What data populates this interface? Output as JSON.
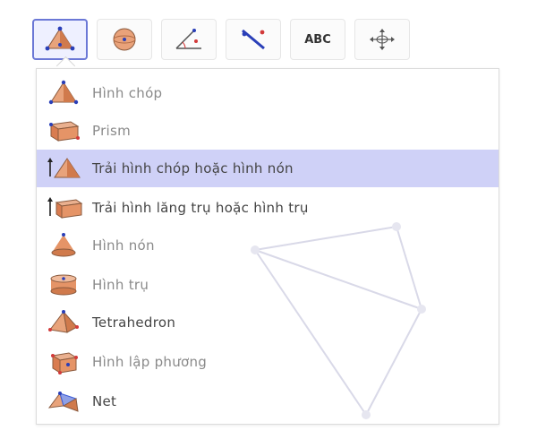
{
  "toolbar": {
    "tools": [
      {
        "name": "pyramid-tool",
        "icon": "pyramid-icon",
        "selected": true
      },
      {
        "name": "sphere-tool",
        "icon": "sphere-icon",
        "selected": false
      },
      {
        "name": "angle-tool",
        "icon": "angle-icon",
        "selected": false
      },
      {
        "name": "reflect-tool",
        "icon": "reflect-icon",
        "selected": false
      },
      {
        "name": "text-tool",
        "label": "ABC",
        "selected": false
      },
      {
        "name": "move-view-tool",
        "icon": "move-arrows-icon",
        "selected": false
      }
    ]
  },
  "menu": {
    "items": [
      {
        "label": "Hình chóp",
        "icon": "pyramid-icon"
      },
      {
        "label": "Prism",
        "icon": "prism-icon"
      },
      {
        "label": "Trải hình chóp hoặc hình nón",
        "icon": "extrude-pyramid-icon",
        "selected": true
      },
      {
        "label": "Trải hình lăng trụ hoặc hình trụ",
        "icon": "extrude-prism-icon"
      },
      {
        "label": "Hình nón",
        "icon": "cone-icon"
      },
      {
        "label": "Hình trụ",
        "icon": "cylinder-icon"
      },
      {
        "label": "Tetrahedron",
        "icon": "tetrahedron-icon"
      },
      {
        "label": "Hình lập phương",
        "icon": "cube-icon"
      },
      {
        "label": "Net",
        "icon": "net-icon"
      }
    ]
  },
  "colors": {
    "selected_bg": "#cfd1f7",
    "selected_tool_border": "#6b78d6",
    "shape_orange": "#e07b48",
    "shape_blue": "#3b5bd6",
    "shape_red": "#d23a3a"
  }
}
